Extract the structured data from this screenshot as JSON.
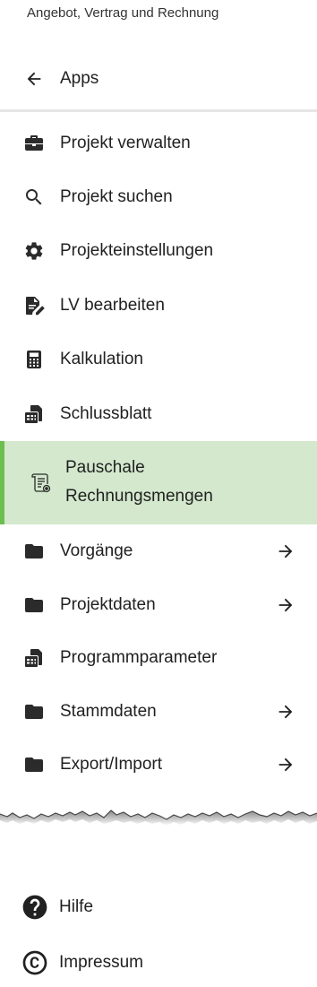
{
  "header": {
    "subtitle": "Angebot, Vertrag und Rechnung"
  },
  "back": {
    "label": "Apps"
  },
  "menu": [
    {
      "label": "Projekt verwalten",
      "icon": "briefcase-icon"
    },
    {
      "label": "Projekt suchen",
      "icon": "search-icon"
    },
    {
      "label": "Projekteinstellungen",
      "icon": "gear-icon"
    },
    {
      "label": "LV bearbeiten",
      "icon": "edit-document-icon"
    },
    {
      "label": "Kalkulation",
      "icon": "calculator-icon"
    },
    {
      "label": "Schlussblatt",
      "icon": "spreadsheet-icon"
    },
    {
      "label_line1": "Pauschale",
      "label_line2": "Rechnungsmengen",
      "icon": "scroll-document-icon",
      "active": true
    },
    {
      "label": "Vorgänge",
      "icon": "folder-icon",
      "arrow": "arrow-right-icon"
    },
    {
      "label": "Projektdaten",
      "icon": "folder-icon",
      "arrow": "arrow-right-icon"
    },
    {
      "label": "Programmparameter",
      "icon": "spreadsheet-icon"
    },
    {
      "label": "Stammdaten",
      "icon": "folder-icon",
      "arrow": "arrow-right-icon"
    },
    {
      "label": "Export/Import",
      "icon": "folder-icon",
      "arrow": "arrow-right-icon"
    }
  ],
  "footer": [
    {
      "label": "Hilfe",
      "icon": "help-circle-icon"
    },
    {
      "label": "Impressum",
      "icon": "copyright-icon"
    }
  ],
  "colors": {
    "active_bg": "#d3e8cd",
    "active_border": "#6cbf4f",
    "text": "#212121"
  }
}
